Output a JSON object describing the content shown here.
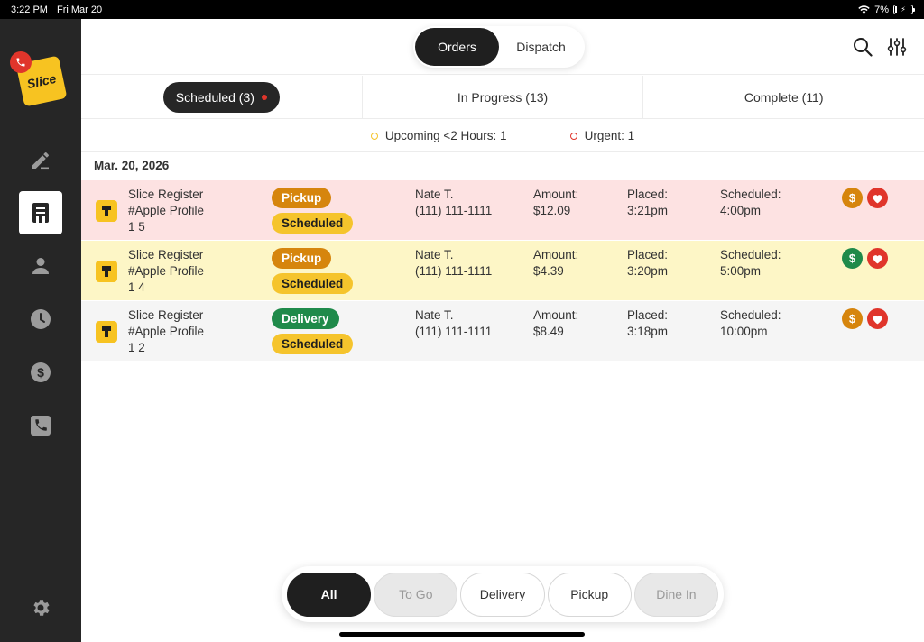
{
  "statusbar": {
    "time": "3:22 PM",
    "date": "Fri Mar 20",
    "battery": "7%"
  },
  "sidebar": {
    "logo_text": "Slice",
    "items": [
      "edit-icon",
      "orders-icon",
      "customer-icon",
      "clock-icon",
      "dollar-icon",
      "phone-icon"
    ],
    "settings": "gear-icon"
  },
  "header": {
    "tabs": [
      "Orders",
      "Dispatch"
    ],
    "active_tab": "Orders"
  },
  "status_tabs": [
    "Scheduled (3)",
    "In Progress (13)",
    "Complete (11)"
  ],
  "legend": [
    {
      "label": "Upcoming <2 Hours: 1",
      "color": "#f5c42c"
    },
    {
      "label": "Urgent: 1",
      "color": "#e0352b"
    }
  ],
  "date_heading": "Mar. 20, 2026",
  "orders": [
    {
      "source": "Slice Register",
      "profile": "#Apple Profile",
      "number": "1 5",
      "type": "Pickup",
      "status": "Scheduled",
      "customer": "Nate T.",
      "phone": "(111) 111-1111",
      "amount_label": "Amount:",
      "amount": "$12.09",
      "placed_label": "Placed:",
      "placed": "3:21pm",
      "scheduled_label": "Scheduled:",
      "scheduled": "4:00pm",
      "pay_color": "#d6850d",
      "bg": "#fde2e2"
    },
    {
      "source": "Slice Register",
      "profile": "#Apple Profile",
      "number": "1 4",
      "type": "Pickup",
      "status": "Scheduled",
      "customer": "Nate T.",
      "phone": "(111) 111-1111",
      "amount_label": "Amount:",
      "amount": "$4.39",
      "placed_label": "Placed:",
      "placed": "3:20pm",
      "scheduled_label": "Scheduled:",
      "scheduled": "5:00pm",
      "pay_color": "#1f8a4a",
      "bg": "#fdf6c6"
    },
    {
      "source": "Slice Register",
      "profile": "#Apple Profile",
      "number": "1 2",
      "type": "Delivery",
      "status": "Scheduled",
      "customer": "Nate T.",
      "phone": "(111) 111-1111",
      "amount_label": "Amount:",
      "amount": "$8.49",
      "placed_label": "Placed:",
      "placed": "3:18pm",
      "scheduled_label": "Scheduled:",
      "scheduled": "10:00pm",
      "pay_color": "#d6850d",
      "bg": "#f5f5f5"
    }
  ],
  "pay_symbol": "$",
  "filters": [
    "All",
    "To Go",
    "Delivery",
    "Pickup",
    "Dine In"
  ],
  "colors": {
    "accent": "#f7c321",
    "urgent": "#e0352b",
    "pickup": "#d6850d",
    "delivery": "#1f8a4a"
  }
}
